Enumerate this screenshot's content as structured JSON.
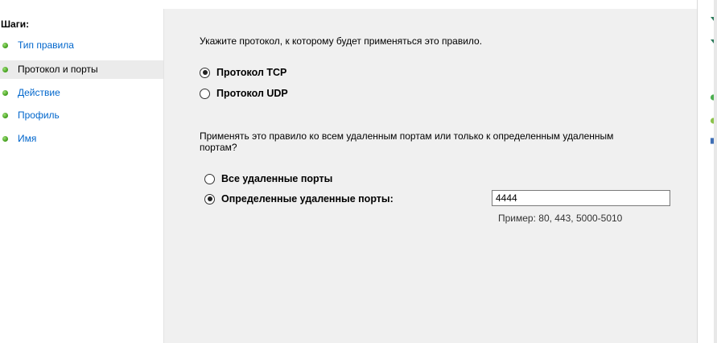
{
  "steps": {
    "title": "Шаги:",
    "items": [
      {
        "label": "Тип правила",
        "active": false
      },
      {
        "label": "Протокол и порты",
        "active": true
      },
      {
        "label": "Действие",
        "active": false
      },
      {
        "label": "Профиль",
        "active": false
      },
      {
        "label": "Имя",
        "active": false
      }
    ]
  },
  "main": {
    "intro": "Укажите протокол, к которому будет применяться это правило.",
    "protocol": {
      "tcp_label": "Протокол TCP",
      "udp_label": "Протокол UDP",
      "selected": "tcp"
    },
    "question": "Применять это правило ко всем удаленным портам или только к определенным удаленным портам?",
    "ports": {
      "all_label": "Все удаленные порты",
      "specific_label": "Определенные удаленные порты:",
      "selected": "specific",
      "value": "4444",
      "example": "Пример: 80, 443, 5000-5010"
    }
  },
  "colors": {
    "link": "#0066cc",
    "panel_bg": "#f0f0f0",
    "active_step_bg": "#ebebeb",
    "step_dot": "#4aa523"
  },
  "icons": [
    "green-dot-icon",
    "radio-icon"
  ]
}
